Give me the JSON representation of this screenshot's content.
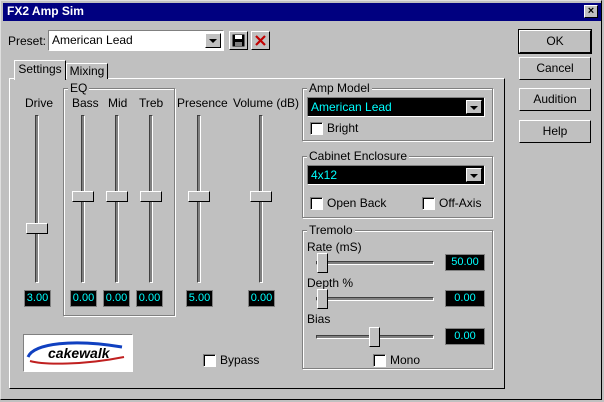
{
  "window": {
    "title": "FX2 Amp Sim",
    "close_glyph": "×"
  },
  "preset": {
    "label": "Preset:",
    "value": "American Lead"
  },
  "buttons": {
    "ok": "OK",
    "cancel": "Cancel",
    "audition": "Audition",
    "help": "Help"
  },
  "tabs": [
    {
      "label": "Settings",
      "active": true
    },
    {
      "label": "Mixing",
      "active": false
    }
  ],
  "settings": {
    "drive": {
      "label": "Drive",
      "value": "3.00"
    },
    "eq": {
      "label": "EQ",
      "bass": {
        "label": "Bass",
        "value": "0.00"
      },
      "mid": {
        "label": "Mid",
        "value": "0.00"
      },
      "treb": {
        "label": "Treb",
        "value": "0.00"
      }
    },
    "presence": {
      "label": "Presence",
      "value": "5.00"
    },
    "volume": {
      "label": "Volume (dB)",
      "value": "0.00"
    },
    "bypass": {
      "label": "Bypass",
      "checked": false
    },
    "logo": "cakewalk"
  },
  "amp_model": {
    "label": "Amp Model",
    "value": "American Lead",
    "bright": {
      "label": "Bright",
      "checked": false
    }
  },
  "cabinet": {
    "label": "Cabinet Enclosure",
    "value": "4x12",
    "open_back": {
      "label": "Open Back",
      "checked": false
    },
    "off_axis": {
      "label": "Off-Axis",
      "checked": false
    }
  },
  "tremolo": {
    "label": "Tremolo",
    "rate": {
      "label": "Rate (mS)",
      "value": "50.00"
    },
    "depth": {
      "label": "Depth %",
      "value": "0.00"
    },
    "bias": {
      "label": "Bias",
      "value": "0.00"
    },
    "mono": {
      "label": "Mono",
      "checked": false
    }
  },
  "colors": {
    "title_bar": "#000080",
    "face": "#c0c0c0",
    "display_bg": "#000000",
    "display_text": "#00ffff"
  }
}
